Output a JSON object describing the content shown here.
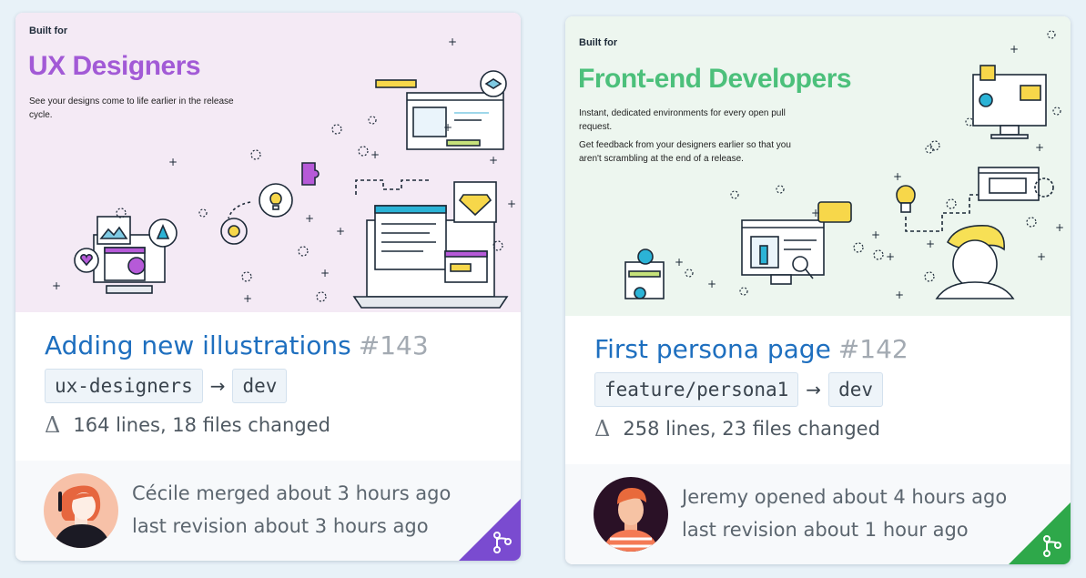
{
  "cards": [
    {
      "built_for": "Built for",
      "persona": "UX Designers",
      "persona_color": "#a25ad6",
      "description": [
        "See your designs come to life earlier in the release cycle."
      ],
      "pr_title": "Adding new illustrations",
      "pr_number": "#143",
      "branch_from": "ux-designers",
      "arrow": "→",
      "branch_to": "dev",
      "changes": "164 lines, 18 files changed",
      "activity_line1": "Cécile merged about 3 hours ago",
      "activity_line2": "last revision about 3 hours ago",
      "status": "merged",
      "status_color": "#7a4bd0",
      "avatar_icon": "woman-avatar-icon"
    },
    {
      "built_for": "Built for",
      "persona": "Front-end Developers",
      "persona_color": "#4cc07b",
      "description": [
        "Instant, dedicated environments for every open pull request.",
        "Get feedback from your designers earlier so that you aren't scrambling at the end of a release."
      ],
      "pr_title": "First persona page",
      "pr_number": "#142",
      "branch_from": "feature/persona1",
      "arrow": "→",
      "branch_to": "dev",
      "changes": "258 lines, 23 files changed",
      "activity_line1": "Jeremy opened about 4 hours ago",
      "activity_line2": "last revision about 1 hour ago",
      "status": "open",
      "status_color": "#2ea84a",
      "avatar_icon": "man-avatar-icon"
    }
  ],
  "icons": {
    "delta": "Δ",
    "branch_icon": "git-branch-icon"
  }
}
